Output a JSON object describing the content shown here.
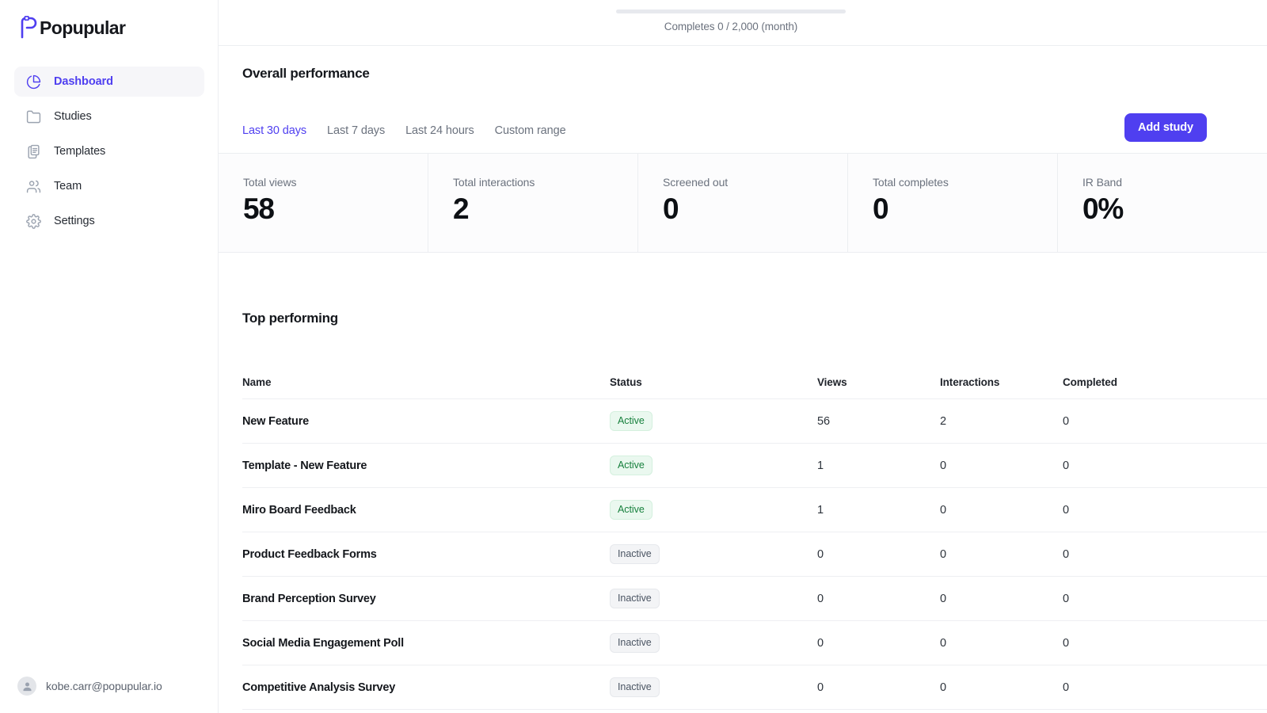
{
  "brand": {
    "name": "Popupular",
    "logo_icon": "popup-bubble-icon",
    "accent_color": "#4f3ff0"
  },
  "sidebar": {
    "items": [
      {
        "label": "Dashboard",
        "icon": "pie-chart-icon",
        "active": true
      },
      {
        "label": "Studies",
        "icon": "folder-icon",
        "active": false
      },
      {
        "label": "Templates",
        "icon": "clipboard-icon",
        "active": false
      },
      {
        "label": "Team",
        "icon": "users-icon",
        "active": false
      },
      {
        "label": "Settings",
        "icon": "gear-icon",
        "active": false
      }
    ],
    "user": {
      "email": "kobe.carr@popupular.io",
      "avatar_icon": "user-avatar-icon"
    }
  },
  "quota": {
    "label": "Completes 0 / 2,000 (month)",
    "current": 0,
    "limit": 2000,
    "period": "month",
    "percent": 0
  },
  "performance": {
    "title": "Overall performance",
    "ranges": [
      {
        "label": "Last 30 days",
        "selected": true
      },
      {
        "label": "Last 7 days",
        "selected": false
      },
      {
        "label": "Last 24 hours",
        "selected": false
      },
      {
        "label": "Custom range",
        "selected": false
      }
    ],
    "add_study_label": "Add study",
    "stats": [
      {
        "label": "Total views",
        "value": "58"
      },
      {
        "label": "Total interactions",
        "value": "2"
      },
      {
        "label": "Screened out",
        "value": "0"
      },
      {
        "label": "Total completes",
        "value": "0"
      },
      {
        "label": "IR Band",
        "value": "0%"
      }
    ]
  },
  "top_performing": {
    "title": "Top performing",
    "columns": [
      "Name",
      "Status",
      "Views",
      "Interactions",
      "Completed"
    ],
    "rows": [
      {
        "name": "New Feature",
        "status": "Active",
        "views": "56",
        "interactions": "2",
        "completed": "0"
      },
      {
        "name": "Template - New Feature",
        "status": "Active",
        "views": "1",
        "interactions": "0",
        "completed": "0"
      },
      {
        "name": "Miro Board Feedback",
        "status": "Active",
        "views": "1",
        "interactions": "0",
        "completed": "0"
      },
      {
        "name": "Product Feedback Forms",
        "status": "Inactive",
        "views": "0",
        "interactions": "0",
        "completed": "0"
      },
      {
        "name": "Brand Perception Survey",
        "status": "Inactive",
        "views": "0",
        "interactions": "0",
        "completed": "0"
      },
      {
        "name": "Social Media Engagement Poll",
        "status": "Inactive",
        "views": "0",
        "interactions": "0",
        "completed": "0"
      },
      {
        "name": "Competitive Analysis Survey",
        "status": "Inactive",
        "views": "0",
        "interactions": "0",
        "completed": "0"
      }
    ]
  }
}
